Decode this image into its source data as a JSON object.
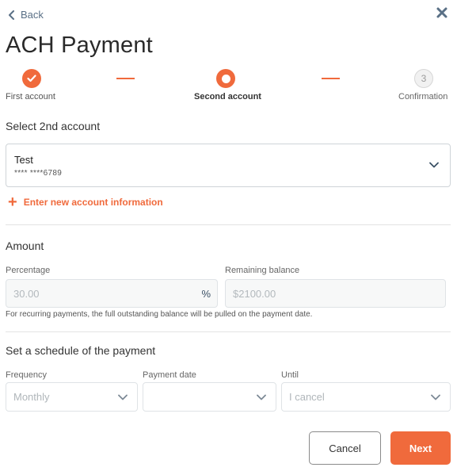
{
  "header": {
    "back_label": "Back",
    "title": "ACH Payment"
  },
  "stepper": {
    "steps": [
      {
        "label": "First account",
        "state": "completed"
      },
      {
        "label": "Second account",
        "state": "current"
      },
      {
        "label": "Confirmation",
        "state": "pending",
        "number": "3"
      }
    ]
  },
  "account_section": {
    "heading": "Select 2nd account",
    "selected_account": {
      "name": "Test",
      "number": "**** ****6789"
    },
    "new_account_label": "Enter new account information"
  },
  "amount_section": {
    "heading": "Amount",
    "percentage": {
      "label": "Percentage",
      "value": "30.00",
      "unit": "%"
    },
    "remaining_balance": {
      "label": "Remaining balance",
      "value": "$2100.00"
    },
    "note": "For recurring payments, the full outstanding balance will be pulled on the payment date."
  },
  "schedule_section": {
    "heading": "Set a schedule of the payment",
    "frequency": {
      "label": "Frequency",
      "value": "Monthly"
    },
    "payment_date": {
      "label": "Payment date",
      "value": ""
    },
    "until": {
      "label": "Until",
      "value": "I cancel"
    }
  },
  "actions": {
    "cancel_label": "Cancel",
    "next_label": "Next"
  },
  "colors": {
    "accent": "#f06a3c",
    "link": "#5a7086"
  }
}
